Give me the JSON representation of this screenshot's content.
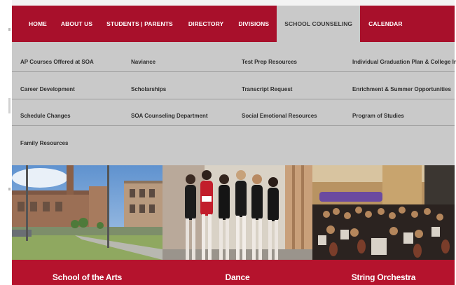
{
  "nav": {
    "items": [
      {
        "label": "HOME"
      },
      {
        "label": "ABOUT US"
      },
      {
        "label": "STUDENTS | PARENTS"
      },
      {
        "label": "DIRECTORY"
      },
      {
        "label": "DIVISIONS"
      },
      {
        "label": "SCHOOL COUNSELING",
        "active": true
      },
      {
        "label": "CALENDAR"
      }
    ]
  },
  "megamenu": {
    "items": [
      {
        "label": "AP Courses Offered at SOA"
      },
      {
        "label": "Naviance"
      },
      {
        "label": "Test Prep Resources"
      },
      {
        "label": "Individual Graduation Plan & College Info"
      },
      {
        "label": "Career Development"
      },
      {
        "label": "Scholarships"
      },
      {
        "label": "Transcript Request"
      },
      {
        "label": "Enrichment & Summer Opportunities"
      },
      {
        "label": "Schedule Changes"
      },
      {
        "label": "SOA Counseling Department"
      },
      {
        "label": "Social Emotional Resources"
      },
      {
        "label": "Program of Studies"
      },
      {
        "label": "Family Resources"
      }
    ]
  },
  "photos": [
    {
      "caption": "School of the Arts"
    },
    {
      "caption": "Dance"
    },
    {
      "caption": "String Orchestra"
    }
  ],
  "colors": {
    "brand_red": "#a8102b",
    "caption_red": "#b5132d",
    "menu_gray": "#c9c9c9"
  }
}
